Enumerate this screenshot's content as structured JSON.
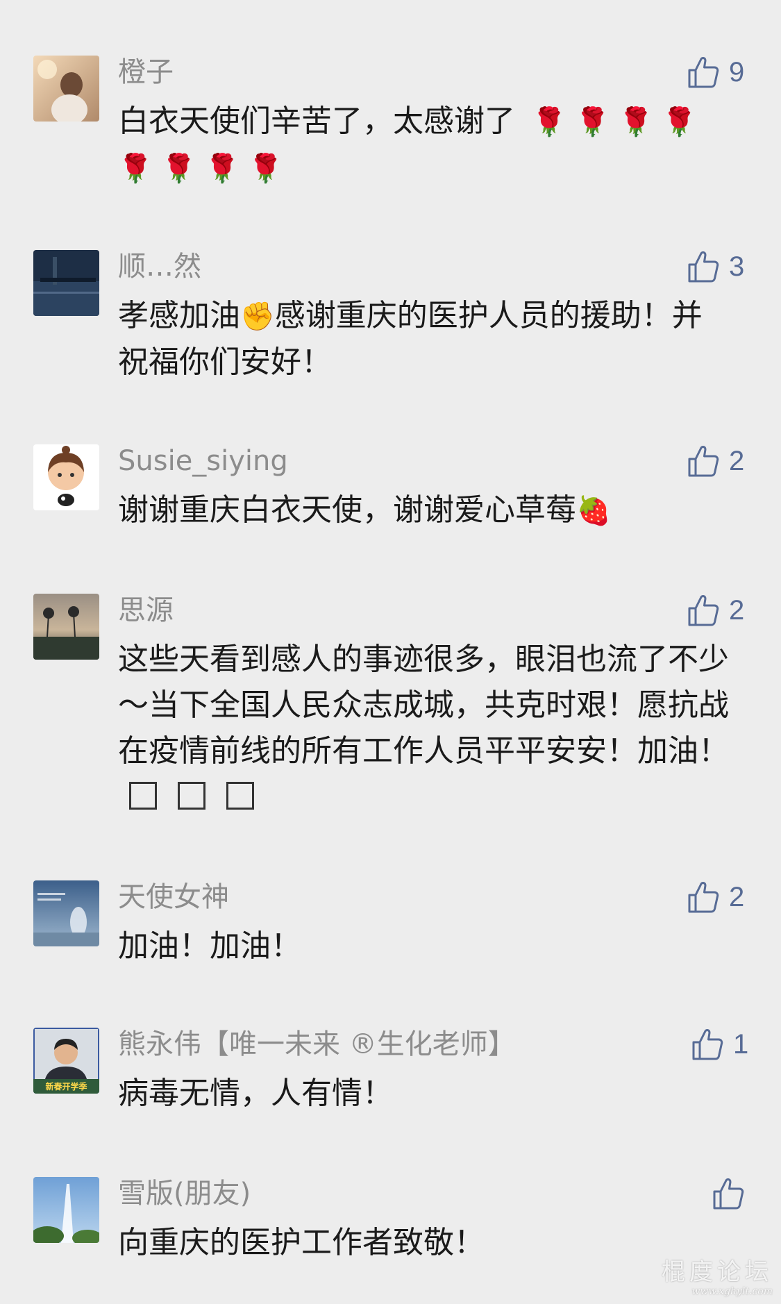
{
  "comments": [
    {
      "nickname": "橙子",
      "text": "白衣天使们辛苦了，太感谢了",
      "emoji": "🌹 🌹 🌹 🌹 🌹 🌹 🌹 🌹",
      "likes": "9"
    },
    {
      "nickname": "顺…然",
      "text_a": "孝感加油",
      "emoji": "✊",
      "text_b": "感谢重庆的医护人员的援助！并祝福你们安好！",
      "likes": "3"
    },
    {
      "nickname": "Susie_siying",
      "text": "谢谢重庆白衣天使，谢谢爱心草莓",
      "emoji": "🍓",
      "likes": "2"
    },
    {
      "nickname": "思源",
      "text": "这些天看到感人的事迹很多，眼泪也流了不少～当下全国人民众志成城，共克时艰！愿抗战在疫情前线的所有工作人员平平安安！加油！",
      "likes": "2"
    },
    {
      "nickname": "天使女神",
      "text": "加油！加油！",
      "likes": "2"
    },
    {
      "nickname": "熊永伟【唯一未来 ®生化老师】",
      "text": "病毒无情，人有情！",
      "likes": "1",
      "avatar_caption": "新春开学季"
    },
    {
      "nickname": "雪版(朋友)",
      "text": "向重庆的医护工作者致敬！",
      "likes": ""
    }
  ],
  "watermark": {
    "title": "棍度论坛",
    "url": "www.xghylt.com"
  },
  "colors": {
    "background": "#ededed",
    "nickname": "#8c8c8c",
    "text": "#1a1a1a",
    "like": "#576b95"
  },
  "icons": {
    "like": "thumbs-up-icon"
  }
}
